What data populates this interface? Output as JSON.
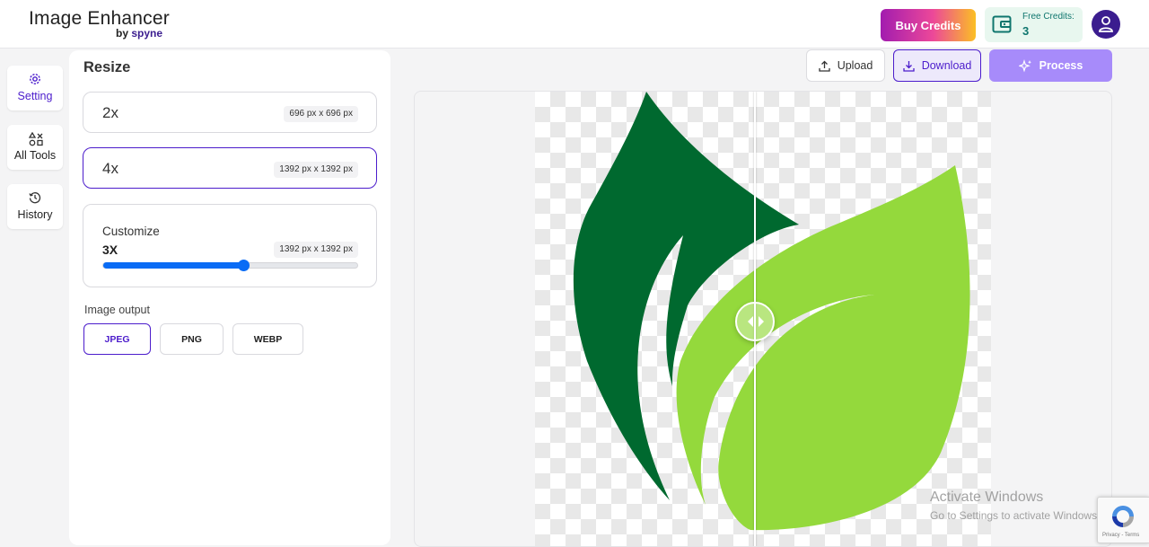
{
  "brand": {
    "title": "Image Enhancer",
    "by": "by",
    "name": "spyne"
  },
  "header": {
    "buy_credits": "Buy Credits",
    "free_credits_label": "Free Credits:",
    "free_credits_value": "3"
  },
  "sidebar": {
    "items": [
      {
        "label": "Setting",
        "icon": "gear-icon",
        "active": true
      },
      {
        "label": "All Tools",
        "icon": "shapes-icon",
        "active": false
      },
      {
        "label": "History",
        "icon": "history-icon",
        "active": false
      }
    ]
  },
  "panel": {
    "title": "Resize",
    "options": [
      {
        "label": "2x",
        "dims": "696 px x 696 px",
        "selected": false
      },
      {
        "label": "4x",
        "dims": "1392 px x 1392 px",
        "selected": true
      }
    ],
    "customize": {
      "label": "Customize",
      "value": "3X",
      "dims": "1392 px x 1392 px",
      "slider_fraction": 0.55
    },
    "output_label": "Image output",
    "formats": [
      {
        "label": "JPEG",
        "selected": true
      },
      {
        "label": "PNG",
        "selected": false
      },
      {
        "label": "WEBP",
        "selected": false
      }
    ]
  },
  "actions": {
    "upload": "Upload",
    "download": "Download",
    "process": "Process"
  },
  "colors": {
    "accent": "#4c1dcc",
    "dark_leaf": "#00692f",
    "light_leaf": "#94d93c",
    "slider": "#0a6cf5"
  },
  "watermark": {
    "title": "Activate Windows",
    "subtitle": "Go to Settings to activate Windows."
  },
  "recaptcha": {
    "terms": "Privacy - Terms"
  }
}
